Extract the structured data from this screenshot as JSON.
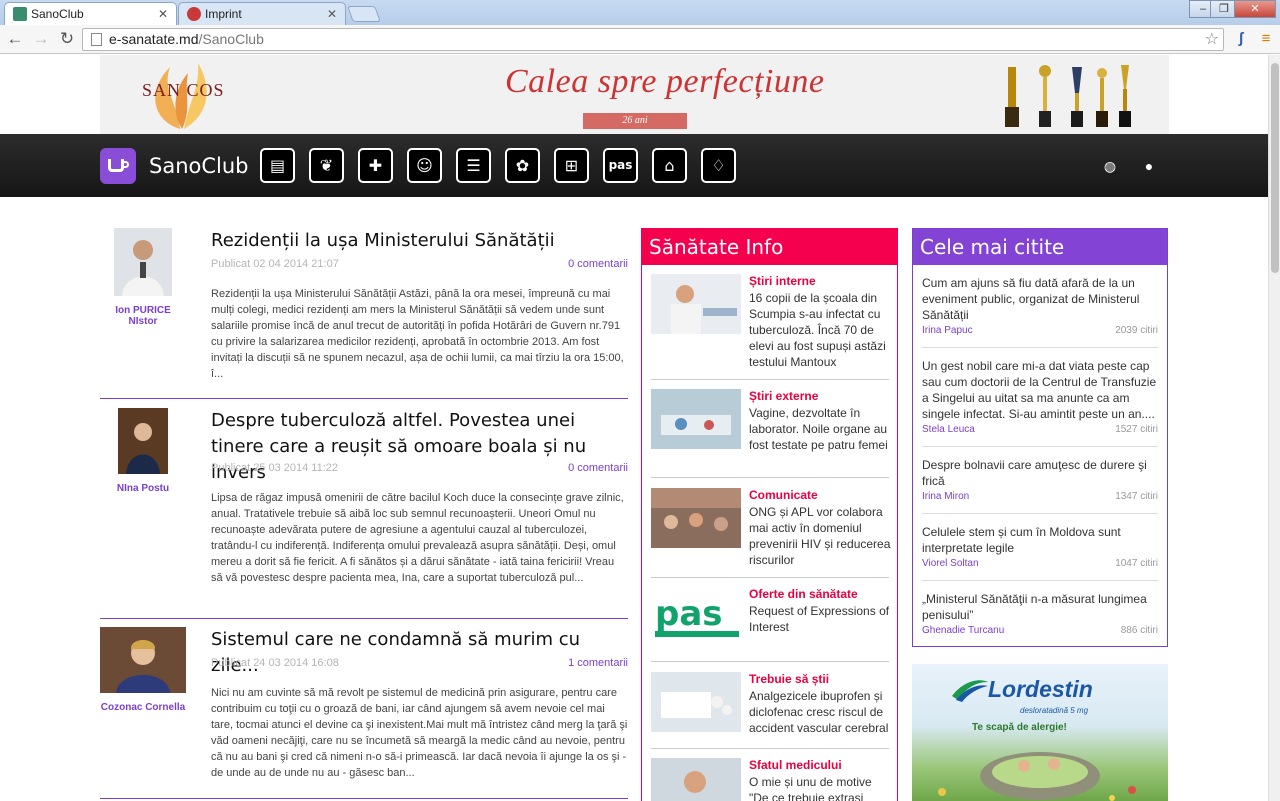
{
  "browser": {
    "tabs": [
      {
        "title": "SanoClub",
        "active": true
      },
      {
        "title": "Imprint",
        "active": false
      }
    ],
    "url_host": "e-sanatate.md",
    "url_path": "/SanoClub"
  },
  "banner": {
    "logo": "SAN COS",
    "slogan": "Calea spre perfecțiune",
    "years": "26 ani"
  },
  "nav": {
    "brand": "SanoClub",
    "categories": [
      {
        "icon": "news-icon",
        "glyph": "▤"
      },
      {
        "icon": "leaf-icon",
        "glyph": "❦"
      },
      {
        "icon": "medical-book-icon",
        "glyph": "✚"
      },
      {
        "icon": "doctor-icon",
        "glyph": "☺"
      },
      {
        "icon": "document-plus-icon",
        "glyph": "☰"
      },
      {
        "icon": "flower-icon",
        "glyph": "✿"
      },
      {
        "icon": "hospital-bed-icon",
        "glyph": "⊞"
      },
      {
        "icon": "pas-logo-icon",
        "glyph": "pas"
      },
      {
        "icon": "graduation-cap-icon",
        "glyph": "⌂"
      },
      {
        "icon": "blood-drop-icon",
        "glyph": "♢"
      }
    ],
    "right_icons": [
      "globe-icon",
      "user-icon"
    ]
  },
  "articles": [
    {
      "title": "Rezidenții la ușa Ministerului Sănătății",
      "author": "Ion PURICE NIstor",
      "published": "Publicat 02 04 2014 21:07",
      "comments": "0 comentarii",
      "excerpt": "Rezidenții la ușa Ministerului Sănătății    Astăzi, până la ora mesei, împreună cu mai mulți colegi, medici rezidenți am mers la Ministerul Sănătății să vedem unde sunt  salariile promise încă de anul trecut de autorități în pofida Hotărâri de Guvern nr.791 cu privire la salarizarea medicilor rezidenți, aprobată în octombrie 2013. Am fost invitați la discuții să ne spunem necazul, așa de ochii lumii, ca mai tîrziu la ora 15:00,  î..."
    },
    {
      "title": "Despre tuberculoză altfel. Povestea unei tinere care a reușit să omoare boala și nu invers",
      "author": "NIna Postu",
      "published": "Publicat 25 03 2014 11:22",
      "comments": "0 comentarii",
      "excerpt": "Lipsa de răgaz impusă omenirii de către bacilul Koch duce la consecințe grave zilnic, anual. Tratativele trebuie să aibă loc sub semnul recunoașterii. Uneori Omul nu recunoaște adevărata putere de agresiune a agentului cauzal al tuberculozei, tratându-l cu indiferență. Indiferența omului prevalează asupra sănătății. Deși, omul mereu a dorit să fie fericit. A fi sănătos și a dărui sănătate - iată taina fericirii! Vreau să vă povestesc despre pacienta mea, Ina, care a suportat tuberculoză pul..."
    },
    {
      "title": "Sistemul care ne condamnă să murim cu zile...",
      "author": "Cozonac Cornella",
      "published": "Publicat 24 03 2014 16:08",
      "comments": "1 comentarii",
      "excerpt": "Nici nu am cuvinte să mă revolt pe sistemul de medicină prin asigurare, pentru care contribuim cu toţii cu o groază de bani, iar când ajungem să avem nevoie cel mai tare, tocmai atunci el devine ca şi inexistent.Mai mult mă întristez când merg la ţară şi văd oameni necăjiţi, care nu se încumetă să meargă la medic când au nevoie, pentru că nu au bani şi cred că nimeni n-o să-i primească. Iar dacă nevoia îi ajunge la os şi - de unde au de unde nu au - găsesc ban..."
    }
  ],
  "sanatate_info": {
    "header": "Sănătate Info",
    "items": [
      {
        "category": "Știri interne",
        "text": "16 copii de la școala din Scumpia s-au infectat cu tuberculoză. Încă 70 de elevi au fost supuși astăzi testului Mantoux"
      },
      {
        "category": "Știri externe",
        "text": "Vagine, dezvoltate în laborator. Noile organe au fost testate pe patru femei"
      },
      {
        "category": "Comunicate",
        "text": "ONG și APL vor colabora mai activ în domeniul prevenirii HIV și reducerea riscurilor"
      },
      {
        "category": "Oferte din sănătate",
        "text": "Request of Expressions of Interest"
      },
      {
        "category": "Trebuie să știi",
        "text": "Analgezicele ibuprofen și diclofenac cresc riscul de accident vascular cerebral"
      },
      {
        "category": "Sfatul medicului",
        "text": "O mie și unu de motive \"De ce trebuie extrasi"
      }
    ]
  },
  "most_read": {
    "header": "Cele mai citite",
    "items": [
      {
        "title": "Cum am ajuns să fiu dată afară de la un eveniment public, organizat de Ministerul Sănătății",
        "author": "Irina Papuc",
        "views": "2039 citiri"
      },
      {
        "title": "Un gest nobil care mi-a dat viata peste cap sau cum doctorii de la Centrul de Transfuzie a Singelui au uitat sa ma anunte ca am singele infectat. Si-au amintit peste un an....",
        "author": "Stela Leuca",
        "views": "1527 citiri"
      },
      {
        "title": "Despre bolnavii care amuţesc de durere şi frică",
        "author": "Irina Miron",
        "views": "1347 citiri"
      },
      {
        "title": "Celulele stem și cum în Moldova sunt interpretate legile",
        "author": "Viorel Soltan",
        "views": "1047 citiri"
      },
      {
        "title": "„Ministerul Sănătăţii n-a măsurat lungimea penisului”",
        "author": "Ghenadie Turcanu",
        "views": "886 citiri"
      }
    ]
  },
  "ad": {
    "brand": "Lordestin",
    "subtitle": "desloratadină 5 mg",
    "tagline": "Te scapă de alergie!"
  }
}
